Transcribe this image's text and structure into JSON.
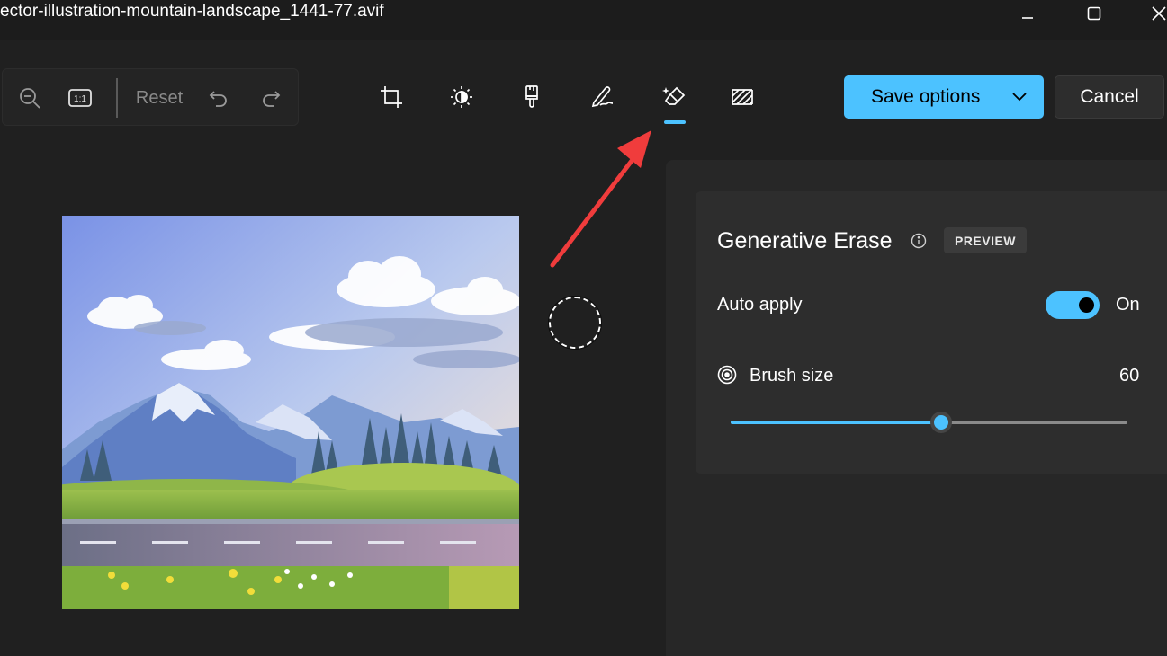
{
  "window": {
    "title": "ector-illustration-mountain-landscape_1441-77.avif"
  },
  "left_toolbar": {
    "zoom_out_icon": "zoom-out-icon",
    "actual_size_label": "1:1",
    "reset_label": "Reset",
    "undo_icon": "undo-icon",
    "redo_icon": "redo-icon"
  },
  "edit_tools": [
    {
      "name": "crop",
      "icon": "crop-icon"
    },
    {
      "name": "adjustment",
      "icon": "brightness-icon"
    },
    {
      "name": "filter",
      "icon": "paint-brush-icon"
    },
    {
      "name": "markup",
      "icon": "pen-icon"
    },
    {
      "name": "erase",
      "icon": "eraser-sparkle-icon",
      "active": true
    },
    {
      "name": "background",
      "icon": "background-blur-icon"
    }
  ],
  "header_actions": {
    "save_label": "Save options",
    "cancel_label": "Cancel"
  },
  "panel": {
    "title": "Generative Erase",
    "badge": "PREVIEW",
    "auto_apply_label": "Auto apply",
    "auto_apply_state": "On",
    "brush_size_label": "Brush size",
    "brush_size_value": "60",
    "brush_size_fraction": 0.53
  },
  "colors": {
    "accent": "#4cc2ff",
    "background": "#202020",
    "panel": "#2d2d2d",
    "annotation_arrow": "#f03c3c"
  }
}
